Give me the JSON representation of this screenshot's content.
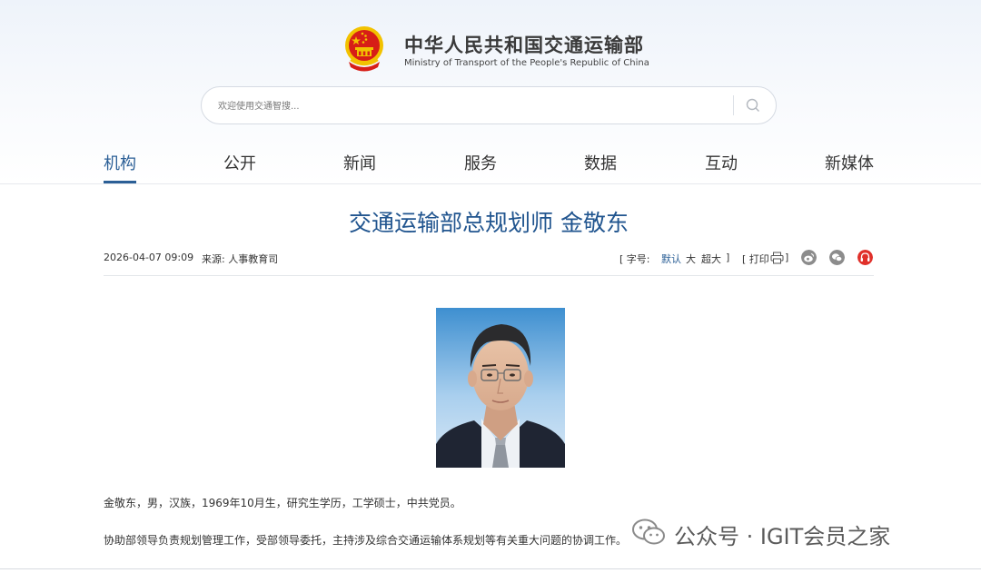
{
  "site": {
    "name_cn": "中华人民共和国交通运输部",
    "name_en": "Ministry of Transport of the People's Republic of China"
  },
  "search": {
    "placeholder": "欢迎使用交通智搜..."
  },
  "nav": {
    "items": [
      {
        "label": "机构",
        "active": true
      },
      {
        "label": "公开",
        "active": false
      },
      {
        "label": "新闻",
        "active": false
      },
      {
        "label": "服务",
        "active": false
      },
      {
        "label": "数据",
        "active": false
      },
      {
        "label": "互动",
        "active": false
      },
      {
        "label": "新媒体",
        "active": false
      }
    ]
  },
  "article": {
    "title": "交通运输部总规划师 金敬东",
    "date": "2026-04-07 09:09",
    "source": "来源: 人事教育司",
    "font_size": {
      "open": "[ 字号:",
      "default": "默认",
      "large": "大",
      "xlarge": "超大",
      "close": "]"
    },
    "print_label": "[ 打印",
    "print_close": "]",
    "share_icons": [
      "weibo-icon",
      "wechat-icon",
      "qzone-icon"
    ],
    "paragraphs": [
      "金敬东，男，汉族，1969年10月生，研究生学历，工学硕士，中共党员。",
      "协助部领导负责规划管理工作，受部领导委托，主持涉及综合交通运输体系规划等有关重大问题的协调工作。"
    ]
  },
  "watermark": {
    "text": "公众号 · IGIT会员之家"
  },
  "colors": {
    "accent": "#2b5f96",
    "title": "#21558f",
    "emblem_red": "#d71e17",
    "emblem_gold": "#f2c200"
  }
}
